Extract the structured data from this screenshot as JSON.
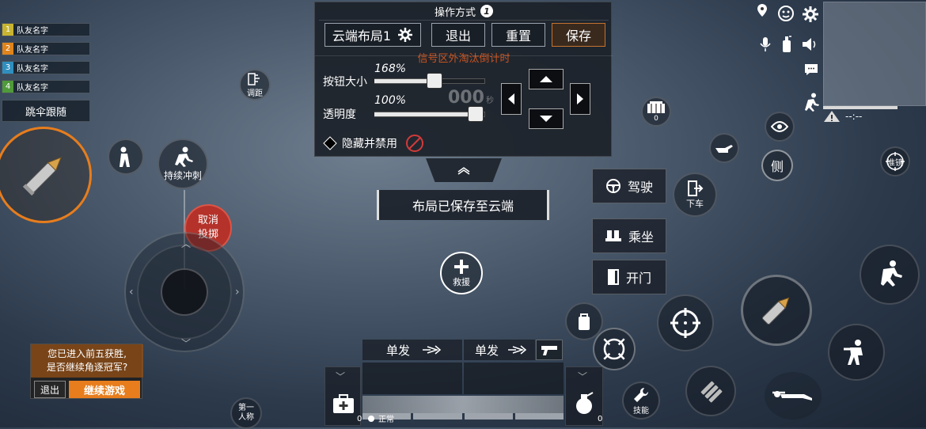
{
  "team": {
    "members": [
      {
        "num": "1",
        "name": "队友名字",
        "color": "#c8b430"
      },
      {
        "num": "2",
        "name": "队友名字",
        "color": "#e0841c"
      },
      {
        "num": "3",
        "name": "队友名字",
        "color": "#2f8fbf"
      },
      {
        "num": "4",
        "name": "队友名字",
        "color": "#4f9a3a"
      }
    ],
    "follow_label": "跳伞跟随"
  },
  "left": {
    "adjust_label": "调距",
    "sprint_label": "持续冲刺",
    "cancel_throw_label": "取消\n投掷",
    "first_person_label": "第一\n人称"
  },
  "prompt": {
    "text": "您已进入前五获胜,\n是否继续角逐冠军?",
    "exit_label": "退出",
    "continue_label": "继续游戏"
  },
  "layout_panel": {
    "title": "操作方式",
    "title_badge": "1",
    "layout_name": "云端布局1",
    "exit_label": "退出",
    "reset_label": "重置",
    "save_label": "保存",
    "overlay_text": "信号区外淘汰倒计时",
    "size_label": "按钮大小",
    "size_value": "168%",
    "size_fraction": 0.55,
    "opacity_label": "透明度",
    "opacity_value": "100%",
    "opacity_fraction": 1.0,
    "countdown_text": "000",
    "countdown_unit": "秒",
    "hide_label": "隐藏并禁用"
  },
  "toast": "布局已保存至云端",
  "rescue_label": "救援",
  "vehicle": {
    "drive_label": "驾驶",
    "ride_label": "乘坐",
    "door_label": "开门",
    "exit_vehicle_label": "下车"
  },
  "right": {
    "supply_count": "0",
    "scope_label": "准镜",
    "side_label": "侧",
    "skill_label": "技能",
    "map_time": "--:--"
  },
  "bottom": {
    "fire_mode_1": "单发",
    "fire_mode_2": "单发",
    "medkit_count": "0",
    "grenade_count": "0",
    "status_label": "正常"
  },
  "colors": {
    "accent_orange": "#e77d1d",
    "cancel_red": "#b4322a",
    "overlay_text": "#c9531f"
  }
}
